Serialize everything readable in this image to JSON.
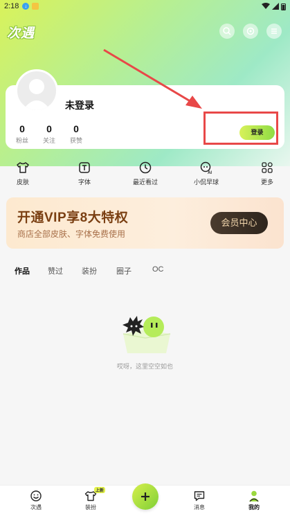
{
  "status_bar": {
    "time": "2:18"
  },
  "app": {
    "logo": "次遇"
  },
  "profile": {
    "name": "未登录",
    "stats": [
      {
        "value": "0",
        "label": "粉丝"
      },
      {
        "value": "0",
        "label": "关注"
      },
      {
        "value": "0",
        "label": "获赞"
      }
    ],
    "login_label": "登录"
  },
  "quick_actions": [
    {
      "label": "皮肤",
      "icon": "shirt-icon"
    },
    {
      "label": "字体",
      "icon": "font-icon"
    },
    {
      "label": "最近看过",
      "icon": "clock-icon"
    },
    {
      "label": "小侃早球",
      "icon": "ai-bot-icon"
    },
    {
      "label": "更多",
      "icon": "grid-icon"
    }
  ],
  "vip": {
    "title": "开通VIP享8大特权",
    "subtitle": "商店全部皮肤、字体免费使用",
    "button": "会员中心"
  },
  "tabs": [
    {
      "label": "作品",
      "active": true
    },
    {
      "label": "赞过",
      "active": false
    },
    {
      "label": "装扮",
      "active": false
    },
    {
      "label": "圈子",
      "active": false
    },
    {
      "label": "OC",
      "active": false
    }
  ],
  "empty_state": {
    "text": "哎呀，这里空空如也"
  },
  "bottom_nav": {
    "items": [
      {
        "label": "次遇",
        "icon": "smile-icon"
      },
      {
        "label": "装扮",
        "icon": "shirt-icon",
        "badge": "上新"
      },
      {
        "label": "消息",
        "icon": "message-icon"
      },
      {
        "label": "我的",
        "icon": "person-icon",
        "active": true
      }
    ]
  },
  "colors": {
    "accent": "#9bd93d",
    "annotation": "#e84848",
    "vip_text": "#7a3f12"
  }
}
